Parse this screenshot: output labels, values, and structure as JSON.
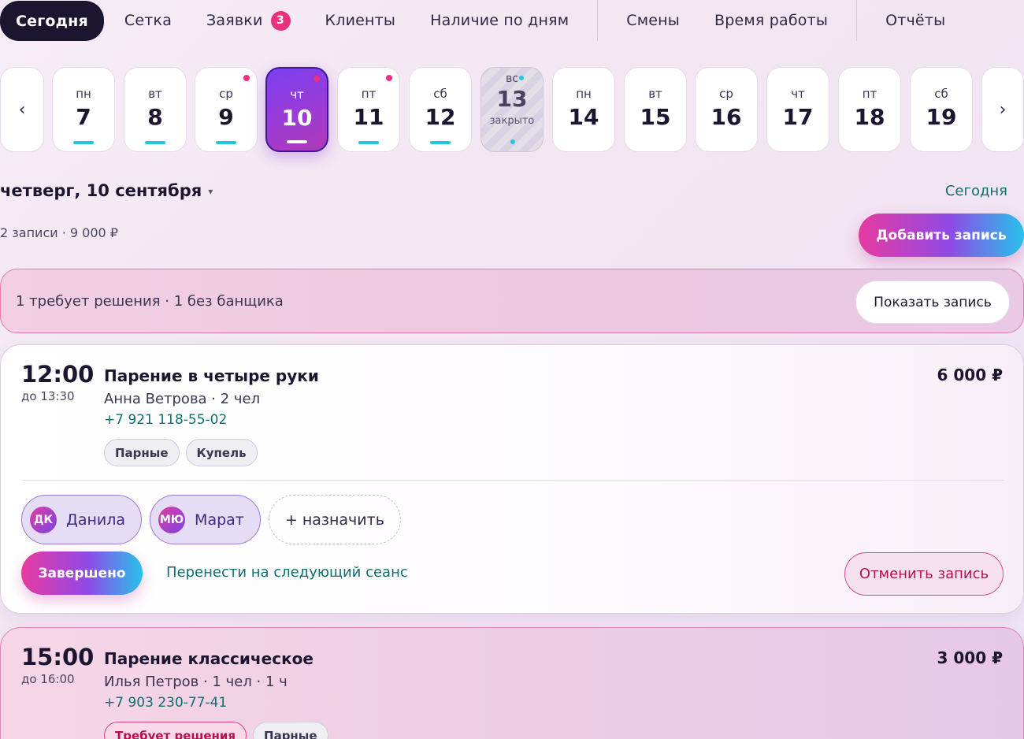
{
  "nav": {
    "tabs": [
      {
        "label": "Сегодня",
        "active": true
      },
      {
        "label": "Сетка"
      },
      {
        "label": "Заявки",
        "badge": "3"
      },
      {
        "label": "Клиенты"
      },
      {
        "label": "Наличие по дням"
      },
      {
        "label": "Смены"
      },
      {
        "label": "Время работы"
      },
      {
        "label": "Отчёты"
      }
    ]
  },
  "dates": {
    "prev_icon": "‹",
    "next_icon": "›",
    "days": [
      {
        "dow": "пн",
        "num": "7"
      },
      {
        "dow": "вт",
        "num": "8"
      },
      {
        "dow": "ср",
        "num": "9"
      },
      {
        "dow": "чт",
        "num": "10"
      },
      {
        "dow": "пт",
        "num": "11"
      },
      {
        "dow": "сб",
        "num": "12"
      },
      {
        "dow": "вс",
        "num": "13",
        "closed_label": "закрыто"
      },
      {
        "dow": "пн",
        "num": "14"
      },
      {
        "dow": "вт",
        "num": "15"
      },
      {
        "dow": "ср",
        "num": "16"
      },
      {
        "dow": "чт",
        "num": "17"
      },
      {
        "dow": "пт",
        "num": "18"
      },
      {
        "dow": "сб",
        "num": "19"
      }
    ]
  },
  "day": {
    "title": "четверг, 10 сентября",
    "caret": "▾",
    "today_link": "Сегодня",
    "summary": "2 записи · 9 000 ₽",
    "add_button": "Добавить запись"
  },
  "alert": {
    "text": "1 требует решения · 1 без банщика",
    "button": "Показать запись"
  },
  "bookings": [
    {
      "time": "12:00",
      "until": "до 13:30",
      "title": "Парение в четыре руки",
      "client": "Анна Ветрова · 2 чел",
      "phone": "+7 921 118-55-02",
      "price": "6 000 ₽",
      "tags": [
        "Парные",
        "Купель"
      ],
      "staff": [
        {
          "initials": "ДК",
          "name": "Данила"
        },
        {
          "initials": "МЮ",
          "name": "Марат"
        }
      ],
      "assign": "+ назначить",
      "done_button": "Завершено",
      "move_link": "Перенести на следующий сеанс",
      "cancel_button": "Отменить запись"
    },
    {
      "time": "15:00",
      "until": "до 16:00",
      "title": "Парение классическое",
      "client": "Илья Петров · 1 чел · 1 ч",
      "phone": "+7 903 230-77-41",
      "price": "3 000 ₽",
      "tags": [
        "Требует решения",
        "Парные"
      ]
    }
  ],
  "colors": {
    "accent_pink": "#e83aa0",
    "accent_violet": "#8f4ae6",
    "accent_cyan": "#27c2ec",
    "teal_text": "#0f6f70",
    "dark": "#1b1530"
  }
}
